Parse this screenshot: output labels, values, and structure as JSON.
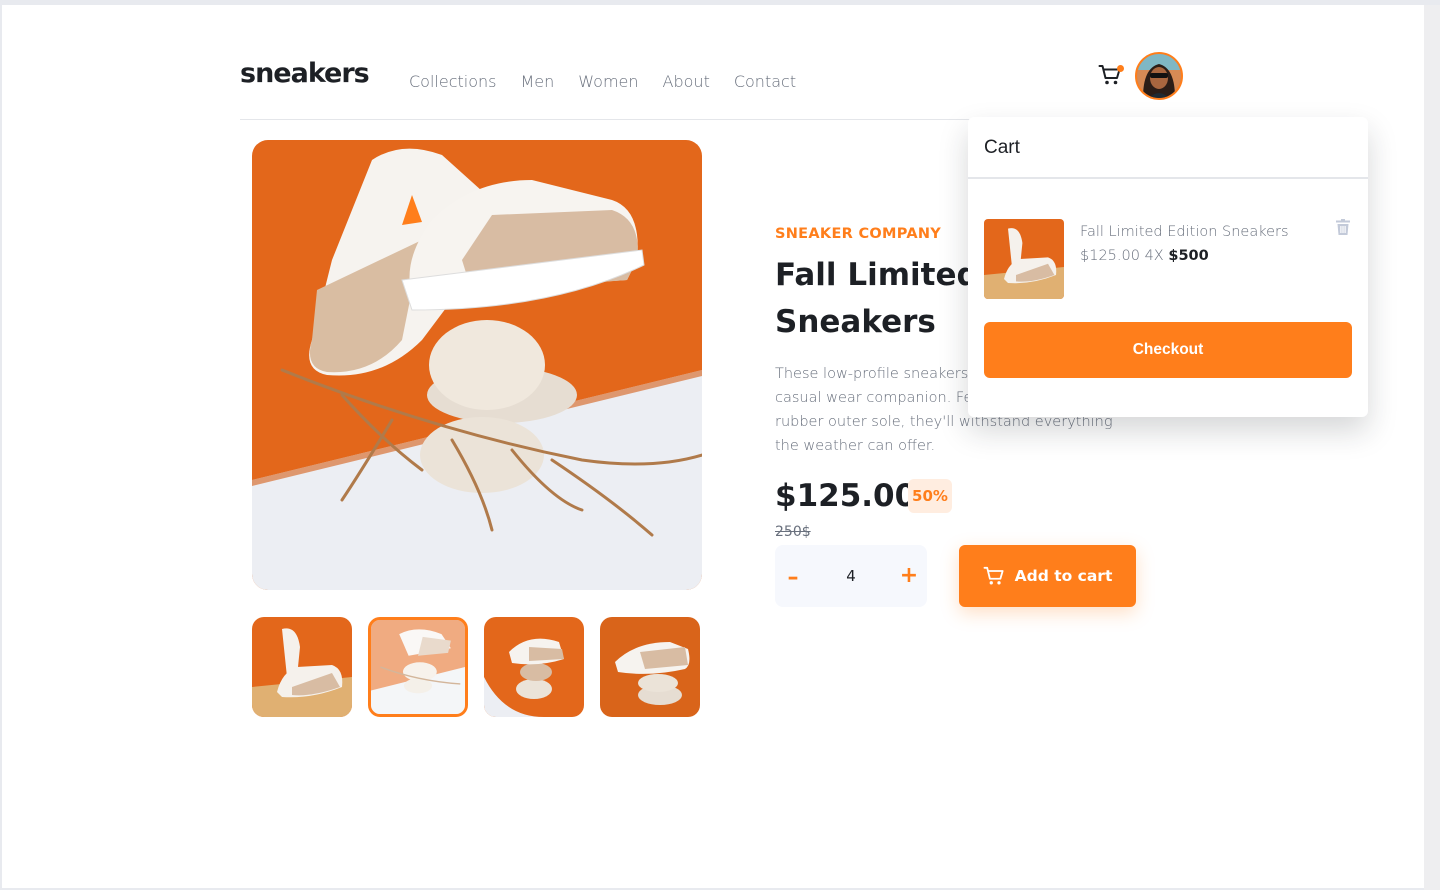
{
  "brand": {
    "logo": "sneakers"
  },
  "nav": {
    "items": [
      "Collections",
      "Men",
      "Women",
      "About",
      "Contact"
    ]
  },
  "header": {
    "cart_icon": "cart-icon",
    "avatar": "user-avatar"
  },
  "product": {
    "company": "SNEAKER COMPANY",
    "title": "Fall Limited Edition Sneakers",
    "description": "These low-profile sneakers are your perfect casual wear companion. Featuring a durable rubber outer sole, they'll withstand everything the weather can offer.",
    "price": "$125.00",
    "discount": "50%",
    "old_price": "250$",
    "quantity": "4",
    "minus_label": "–",
    "plus_label": "+",
    "add_to_cart_label": "Add to cart"
  },
  "gallery": {
    "thumbnails": 4,
    "active_thumbnail": 2
  },
  "cart": {
    "title": "Cart",
    "item_name": "Fall Limited Edition Sneakers",
    "item_unit_price": "$125.00",
    "item_qty": "4X",
    "item_total": "$500",
    "checkout_label": "Checkout",
    "delete_icon": "trash-icon"
  },
  "colors": {
    "accent": "#ff7e1b",
    "text_dark": "#1d2025",
    "text_muted": "#69707d",
    "badge_bg": "#ffede0"
  }
}
